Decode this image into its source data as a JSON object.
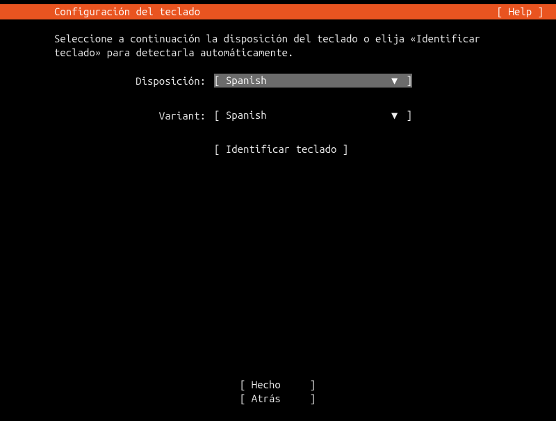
{
  "header": {
    "title": "Configuración del teclado",
    "help": "[ Help ]"
  },
  "instructions": "Seleccione a continuación la disposición del teclado o elija «Identificar teclado» para detectarla automáticamente.",
  "form": {
    "layout_label": "Disposición:",
    "layout_value": "Spanish",
    "variant_label": "Variant:",
    "variant_value": "Spanish"
  },
  "buttons": {
    "identify": "[ Identificar teclado ]",
    "done": "[ Hecho     ]",
    "back": "[ Atrás     ]"
  },
  "glyphs": {
    "arrow_down": "▼",
    "bracket_open": "[ ",
    "bracket_close": " ]"
  }
}
